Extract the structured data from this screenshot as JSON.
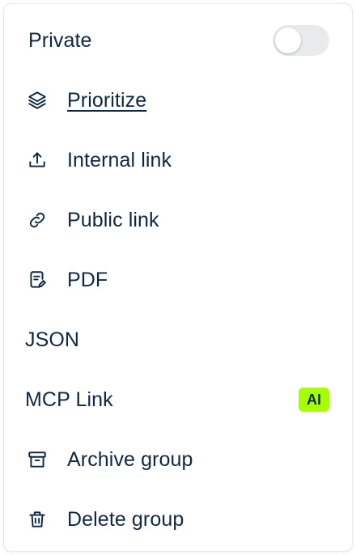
{
  "menu": {
    "private": {
      "label": "Private",
      "enabled": false
    },
    "items": [
      {
        "label": "Prioritize",
        "icon": "layers-icon"
      },
      {
        "label": "Internal link",
        "icon": "upload-icon"
      },
      {
        "label": "Public link",
        "icon": "link-icon"
      },
      {
        "label": "PDF",
        "icon": "document-icon"
      },
      {
        "label": "JSON"
      },
      {
        "label": "MCP Link",
        "badge": "AI"
      },
      {
        "label": "Archive group",
        "icon": "archive-icon"
      },
      {
        "label": "Delete group",
        "icon": "trash-icon"
      }
    ]
  },
  "colors": {
    "text": "#0f2744",
    "badge": "#a6ff00",
    "toggle_off": "#e9eaec"
  }
}
